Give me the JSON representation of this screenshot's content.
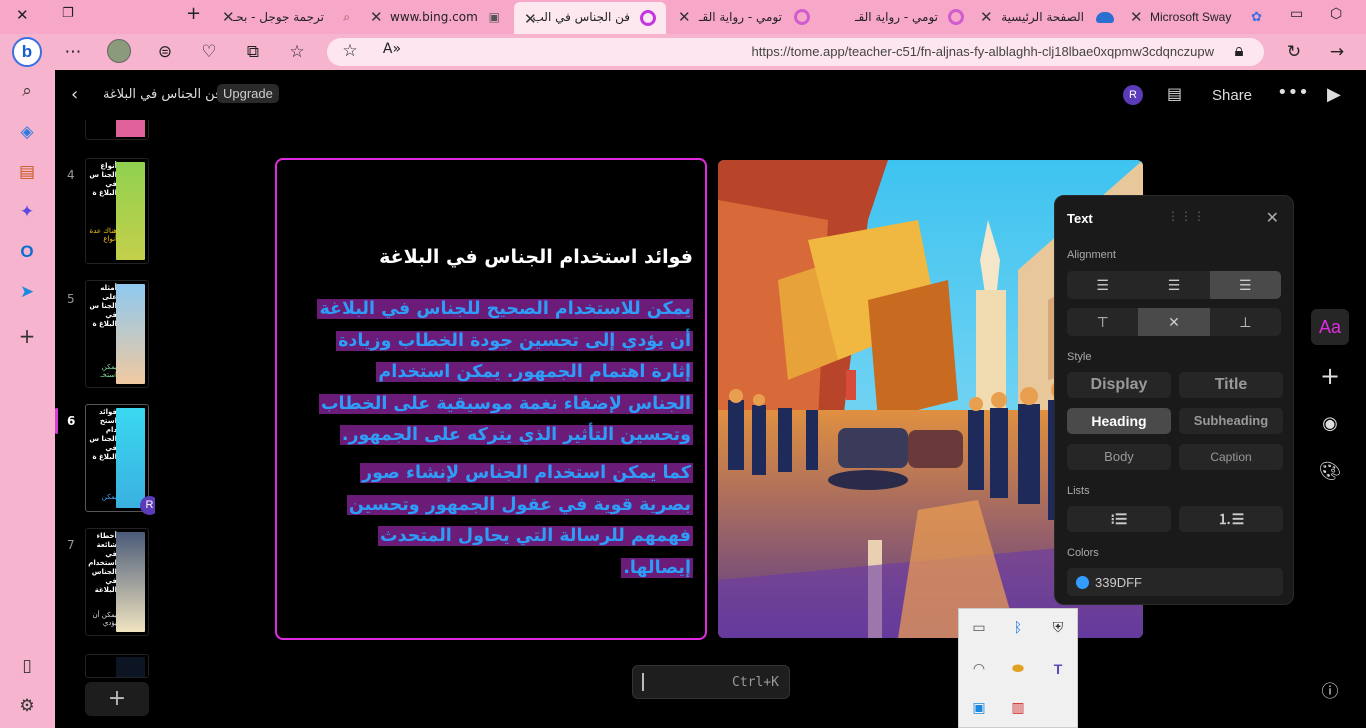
{
  "browser": {
    "tabs": [
      {
        "label": "ترجمة جوجل - بحـ"
      },
      {
        "label": "www.bing.com"
      },
      {
        "label": "فن الجناس في الب"
      },
      {
        "label": "تومي - رواية القـ"
      },
      {
        "label": "تومي - رواية القـ"
      },
      {
        "label": "الصفحة الرئيسية"
      },
      {
        "label": "Microsoft Sway"
      }
    ],
    "url": "https://tome.app/teacher-c51/fn-aljnas-fy-alblaghh-clj18lbae0xqpmw3cdqnczupw"
  },
  "app": {
    "doc_title": "فن الجناس في البلاغة",
    "upgrade_label": "Upgrade",
    "avatar_initial": "R",
    "share_label": "Share"
  },
  "thumbnails": [
    {
      "num": "4",
      "title": "أنواع الجنا س في البلاغ ة",
      "sub": "هناك عدة أنواع",
      "sub_color": "#f5c518",
      "colors": [
        "#8fd14f",
        "#c4d04a"
      ]
    },
    {
      "num": "5",
      "title": "أمثله على الجنا س في البلاغ ة",
      "sub": "يمكن استخـ",
      "sub_color": "#7fe0a0",
      "colors": [
        "#8ec9f0",
        "#f0c9a0"
      ]
    },
    {
      "num": "6",
      "title": "فوائد استخ دام الجنا س في البلاغ ة",
      "sub": "يمكن",
      "sub_color": "#4aa8ff",
      "colors": [
        "#3ad8f0",
        "#3ab0e0"
      ]
    },
    {
      "num": "7",
      "title": "أخطاء شائعة في استخدام الجناس في البلاغة",
      "sub": "يمكن أن يؤدي",
      "sub_color": "#dddddd",
      "colors": [
        "#4a5a78",
        "#f0e4c0"
      ]
    }
  ],
  "slide": {
    "heading": "فوائد استخدام الجناس في البلاغة",
    "para1": "يمكن للاستخدام الصحيح للجناس في البلاغة أن يؤدي إلى تحسين جودة الخطاب وزيادة إثارة اهتمام الجمهور. يمكن استخدام الجناس لإضفاء نغمة موسيقية على الخطاب وتحسين التأثير الذي يتركه على الجمهور.",
    "para2": "كما يمكن استخدام الجناس لإنشاء صور بصرية قوية في عقول الجمهور وتحسين فهمهم للرسالة التي يحاول المتحدث إيصالها.",
    "text_color": "#339DFF",
    "highlight_color": "#6a1c78"
  },
  "text_panel": {
    "title": "Text",
    "alignment_label": "Alignment",
    "style_label": "Style",
    "styles": [
      "Display",
      "Title",
      "Heading",
      "Subheading",
      "Body",
      "Caption"
    ],
    "selected_style": "Heading",
    "lists_label": "Lists",
    "colors_label": "Colors",
    "color_value": "339DFF"
  },
  "rail": {
    "text_label": "Aa"
  },
  "command_bar": {
    "hint": "Ctrl+K"
  }
}
